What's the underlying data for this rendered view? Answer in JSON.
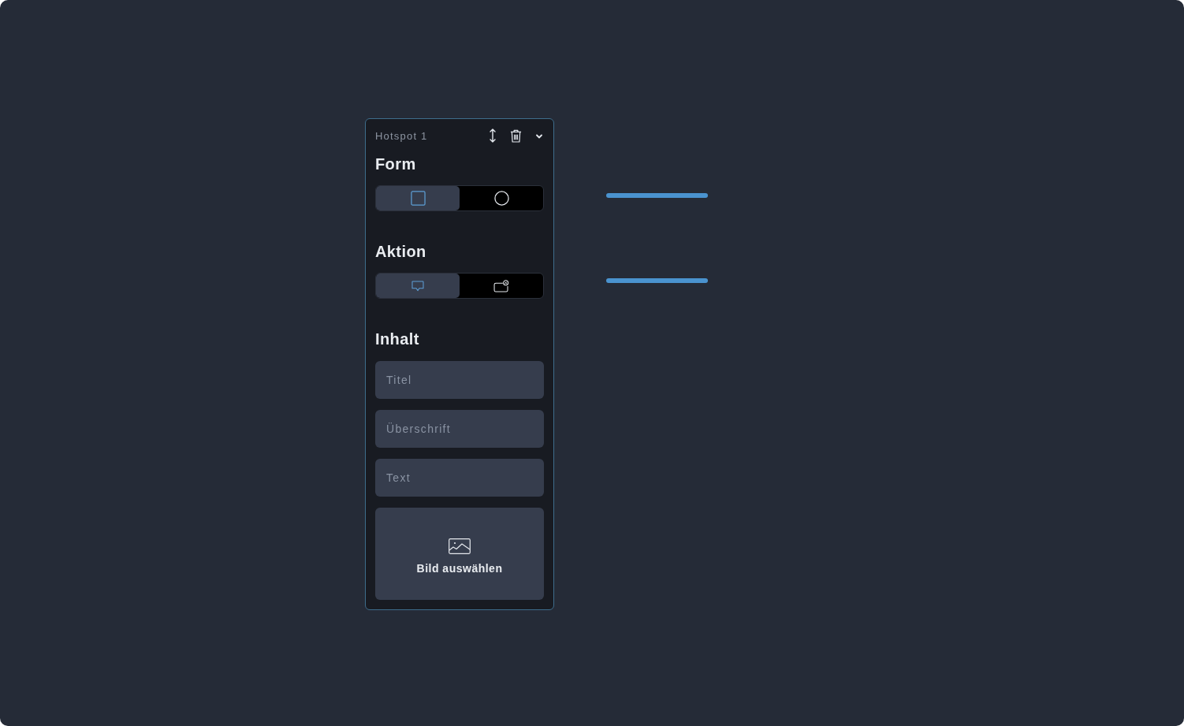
{
  "panel": {
    "title": "Hotspot 1",
    "form": {
      "heading": "Form",
      "options": [
        {
          "kind": "square",
          "selected": true
        },
        {
          "kind": "circle",
          "selected": false
        }
      ]
    },
    "action": {
      "heading": "Aktion",
      "options": [
        {
          "kind": "speech-bubble",
          "selected": true
        },
        {
          "kind": "window-close",
          "selected": false
        }
      ]
    },
    "content": {
      "heading": "Inhalt",
      "fields": [
        {
          "placeholder": "Titel"
        },
        {
          "placeholder": "Überschrift"
        },
        {
          "placeholder": "Text"
        }
      ],
      "image_button": {
        "label": "Bild auswählen"
      }
    }
  }
}
